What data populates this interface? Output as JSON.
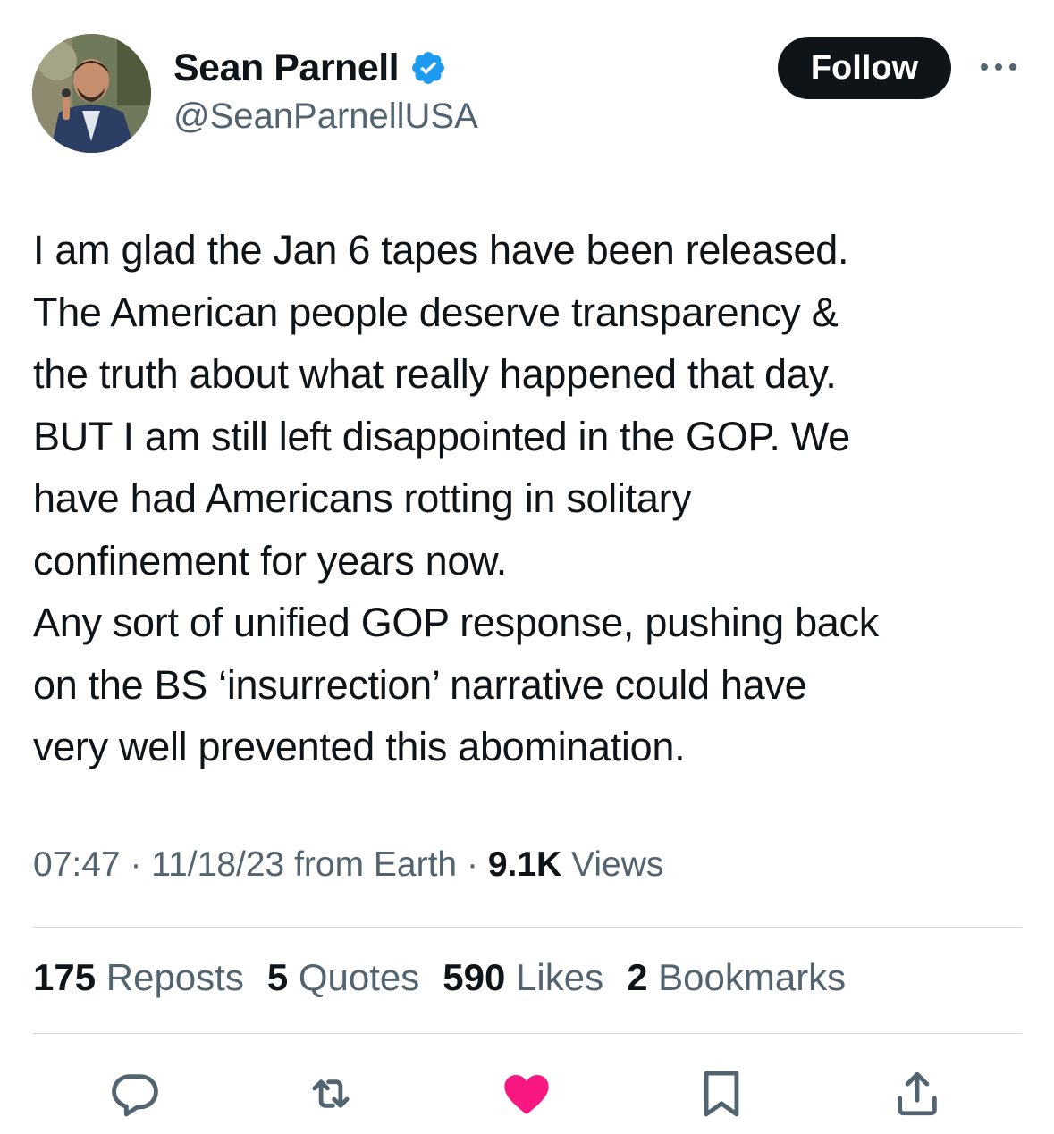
{
  "user": {
    "display_name": "Sean Parnell",
    "handle": "@SeanParnellUSA"
  },
  "header": {
    "follow_label": "Follow"
  },
  "tweet": {
    "text": "I am glad the Jan 6 tapes have been released.\nThe American people deserve transparency &\nthe truth about what really happened that day.\nBUT I am still left disappointed in the GOP. We\nhave had Americans rotting in solitary\nconfinement for years now.\nAny sort of unified GOP response, pushing back\non the BS ‘insurrection’ narrative could have\nvery well prevented this abomination.",
    "time": "07:47",
    "separator": "·",
    "date": "11/18/23",
    "source": "from Earth",
    "views_count": "9.1K",
    "views_label": "Views"
  },
  "stats": {
    "reposts": {
      "count": "175",
      "label": "Reposts"
    },
    "quotes": {
      "count": "5",
      "label": "Quotes"
    },
    "likes": {
      "count": "590",
      "label": "Likes"
    },
    "bookmarks": {
      "count": "2",
      "label": "Bookmarks"
    }
  },
  "actions": {
    "reply_icon": "reply-icon",
    "repost_icon": "repost-icon",
    "like_icon": "heart-filled-icon",
    "bookmark_icon": "bookmark-icon",
    "share_icon": "share-icon"
  },
  "colors": {
    "verified": "#1d9bf0",
    "like_active": "#f91880",
    "secondary_text": "#536471",
    "primary_text": "#0f1419",
    "follow_bg": "#0f1419"
  }
}
